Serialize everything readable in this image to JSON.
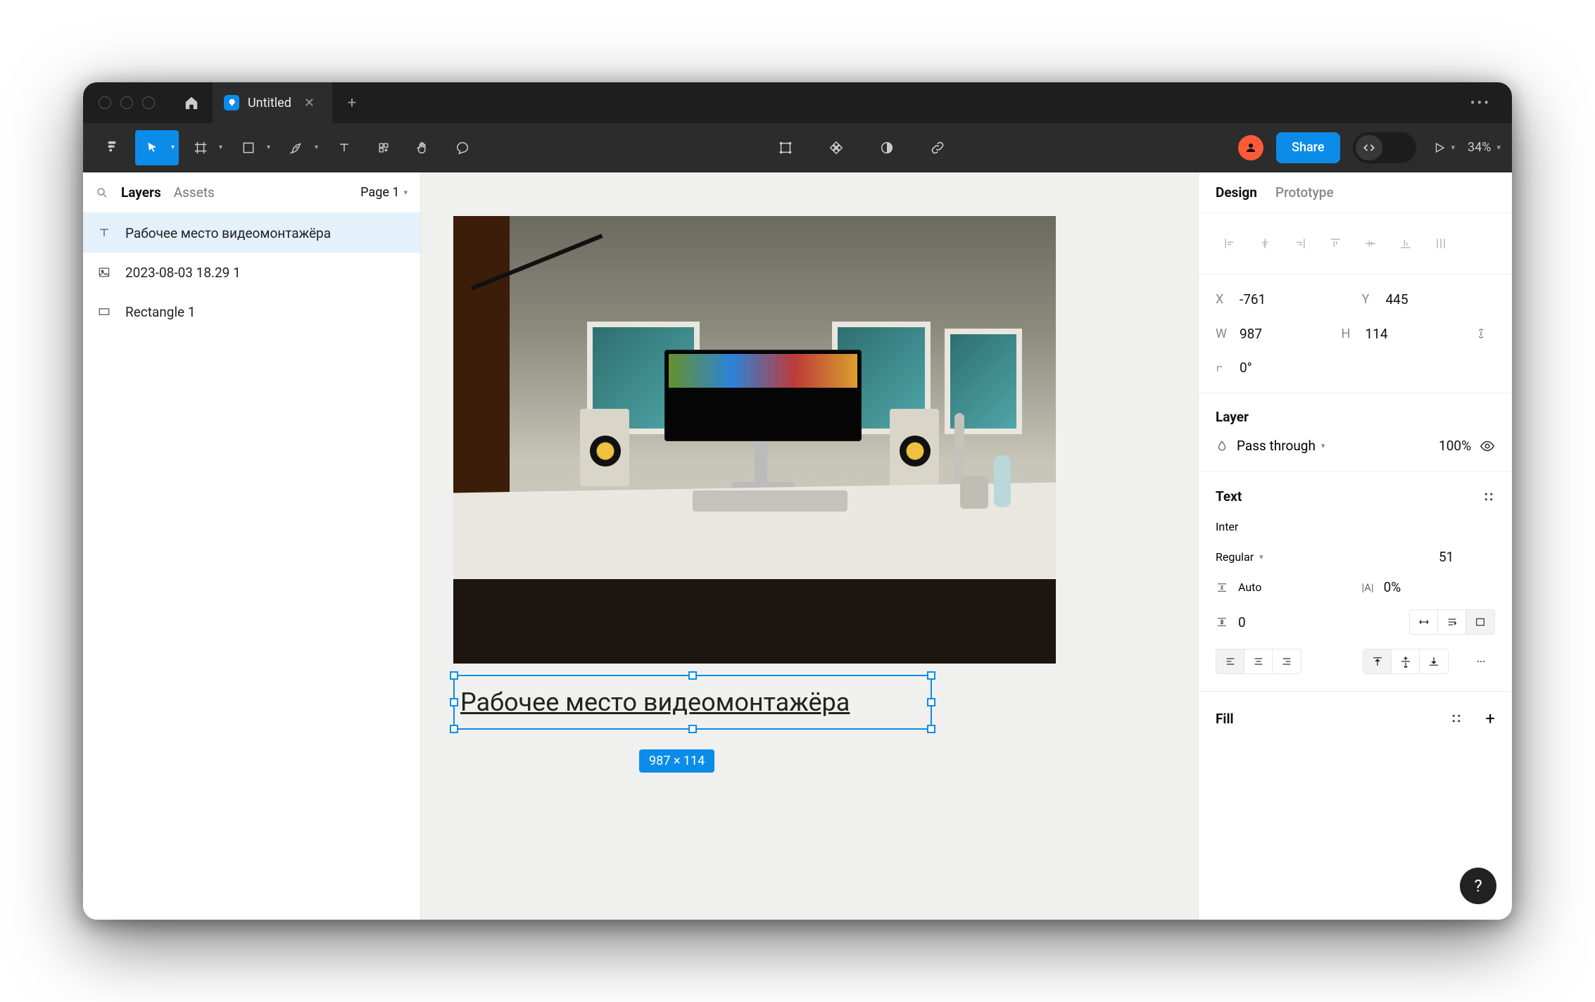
{
  "titlebar": {
    "tab_name": "Untitled"
  },
  "toolbar": {
    "share_label": "Share",
    "zoom_label": "34%"
  },
  "left_panel": {
    "tabs": {
      "layers": "Layers",
      "assets": "Assets"
    },
    "page_label": "Page 1",
    "layers": [
      {
        "icon": "text",
        "name": "Рабочее место видеомонтажёра",
        "selected": true
      },
      {
        "icon": "image",
        "name": "2023-08-03 18.29 1",
        "selected": false
      },
      {
        "icon": "rect",
        "name": "Rectangle 1",
        "selected": false
      }
    ]
  },
  "canvas": {
    "selected_text": "Рабочее место видеомонтажёра",
    "dim_badge": "987 × 114"
  },
  "right_panel": {
    "tabs": {
      "design": "Design",
      "prototype": "Prototype"
    },
    "transform": {
      "x_label": "X",
      "x": "-761",
      "y_label": "Y",
      "y": "445",
      "w_label": "W",
      "w": "987",
      "h_label": "H",
      "h": "114",
      "r_label": "⟀",
      "r": "0°"
    },
    "layer_section": {
      "title": "Layer",
      "blend": "Pass through",
      "opacity": "100%"
    },
    "text_section": {
      "title": "Text",
      "font_family": "Inter",
      "font_weight": "Regular",
      "font_size": "51",
      "line_height_label": "Auto",
      "letter_spacing": "0%",
      "paragraph_spacing": "0"
    },
    "fill_section": {
      "title": "Fill"
    }
  }
}
